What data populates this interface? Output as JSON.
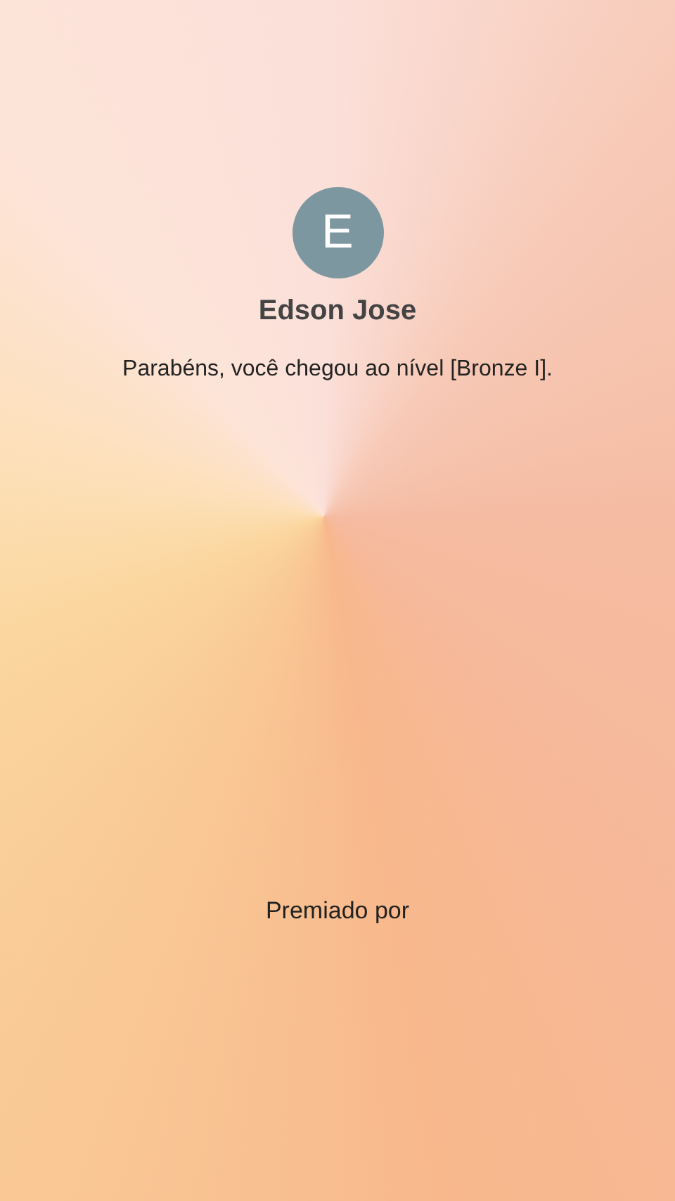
{
  "user": {
    "initial": "E",
    "name": "Edson Jose"
  },
  "message": "Parabéns, você chegou ao nível [Bronze I].",
  "footer": {
    "label": "Premiado por"
  }
}
